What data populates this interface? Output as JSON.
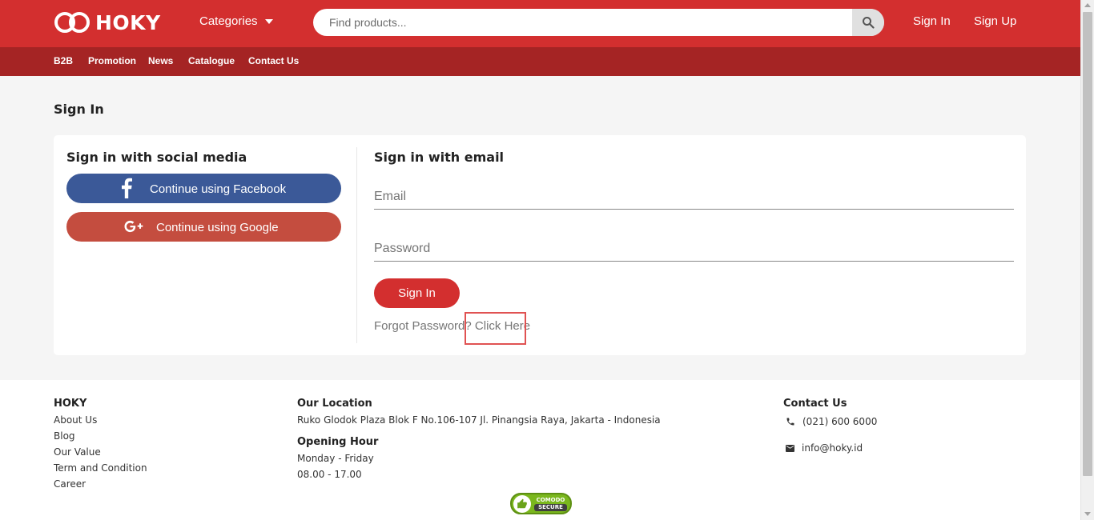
{
  "header": {
    "logo_text": "HOKY",
    "categories_label": "Categories",
    "search_placeholder": "Find products...",
    "sign_in": "Sign In",
    "sign_up": "Sign Up"
  },
  "subnav": [
    "B2B",
    "Promotion",
    "News",
    "Catalogue",
    "Contact Us"
  ],
  "page": {
    "title": "Sign In",
    "social": {
      "heading": "Sign in with social media",
      "facebook": "Continue using Facebook",
      "google": "Continue using Google"
    },
    "email": {
      "heading": "Sign in with email",
      "email_placeholder": "Email",
      "password_placeholder": "Password",
      "submit": "Sign In",
      "forgot_text": "Forgot Password?",
      "forgot_link": "Click Here"
    }
  },
  "footer": {
    "hoky": {
      "title": "HOKY",
      "links": [
        "About Us",
        "Blog",
        "Our Value",
        "Term and Condition",
        "Career"
      ]
    },
    "location": {
      "title": "Our Location",
      "address": "Ruko Glodok Plaza Blok F No.106-107 Jl. Pinangsia Raya, Jakarta - Indonesia",
      "hours_title": "Opening Hour",
      "days": "Monday - Friday",
      "hours": "08.00 - 17.00"
    },
    "contact": {
      "title": "Contact Us",
      "phone": "(021) 600 6000",
      "email": "info@hoky.id"
    },
    "badge": {
      "line1": "COMODO",
      "line2": "SECURE"
    }
  },
  "colors": {
    "primary": "#d32f2f",
    "subnav": "#a52424",
    "facebook": "#3b5998",
    "google": "#c44d3f"
  }
}
